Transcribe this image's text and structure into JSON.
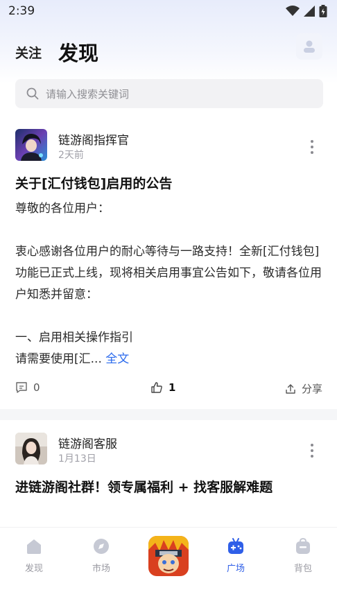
{
  "status_bar": {
    "time": "2:39"
  },
  "header": {
    "follow_tab": "关注",
    "discover_tab": "发现"
  },
  "search": {
    "placeholder": "请输入搜索关键词"
  },
  "posts": [
    {
      "author": "链游阁指挥官",
      "time": "2天前",
      "title": "关于[汇付钱包]启用的公告",
      "body_lines": [
        "尊敬的各位用户：",
        "",
        "衷心感谢各位用户的耐心等待与一路支持！全新[汇付钱包]功能已正式上线，现将相关启用事宜公告如下，敬请各位用户知悉并留意：",
        "",
        "一、启用相关操作指引"
      ],
      "truncated_line": "请需要使用[汇...",
      "full_text_link": "全文",
      "comments": "0",
      "likes": "1",
      "share_label": "分享"
    },
    {
      "author": "链游阁客服",
      "time": "1月13日",
      "title": "进链游阁社群！领专属福利 + 找客服解难题"
    }
  ],
  "bottom_nav": {
    "items": [
      {
        "label": "发现",
        "icon": "home-icon"
      },
      {
        "label": "市场",
        "icon": "compass-icon"
      },
      {
        "label": "",
        "icon": "game-avatar"
      },
      {
        "label": "广场",
        "icon": "gamepad-icon",
        "active": true
      },
      {
        "label": "背包",
        "icon": "bag-icon"
      }
    ]
  },
  "colors": {
    "accent": "#2f5fe8",
    "link": "#2c6bed",
    "inactive": "#c6c9d4"
  }
}
